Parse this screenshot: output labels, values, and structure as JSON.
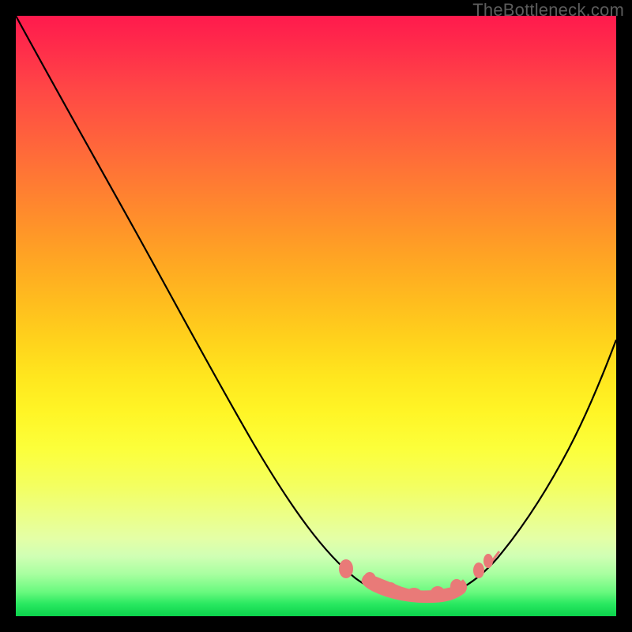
{
  "watermark": "TheBottleneck.com",
  "colors": {
    "pink_marker": "#e97a78",
    "curve": "#000000",
    "frame": "#000000"
  },
  "chart_data": {
    "type": "line",
    "title": "",
    "xlabel": "",
    "ylabel": "",
    "xlim": [
      0,
      100
    ],
    "ylim": [
      0,
      100
    ],
    "grid": false,
    "legend": false,
    "background": "rainbow-gradient-red-to-green",
    "series": [
      {
        "name": "bottleneck-curve",
        "x": [
          0,
          6,
          12,
          18,
          24,
          30,
          36,
          42,
          48,
          54,
          58,
          62,
          66,
          70,
          74,
          78,
          82,
          86,
          90,
          94,
          100
        ],
        "y": [
          100,
          90,
          80,
          70,
          60,
          50,
          41,
          32,
          23,
          15,
          10,
          6,
          4,
          3,
          4,
          6,
          11,
          18,
          28,
          40,
          56
        ]
      }
    ],
    "annotations": [
      {
        "name": "trough-marker-cluster",
        "kind": "cluster",
        "color": "#e97a78",
        "points": [
          {
            "x": 56,
            "y": 9
          },
          {
            "x": 60,
            "y": 6
          },
          {
            "x": 63,
            "y": 4.5
          },
          {
            "x": 66,
            "y": 3.6
          },
          {
            "x": 69,
            "y": 3.2
          },
          {
            "x": 72,
            "y": 3.6
          },
          {
            "x": 75,
            "y": 5
          },
          {
            "x": 78,
            "y": 7.4
          }
        ]
      }
    ],
    "value_at_minimum": {
      "x": 69,
      "y": 3.2
    }
  }
}
